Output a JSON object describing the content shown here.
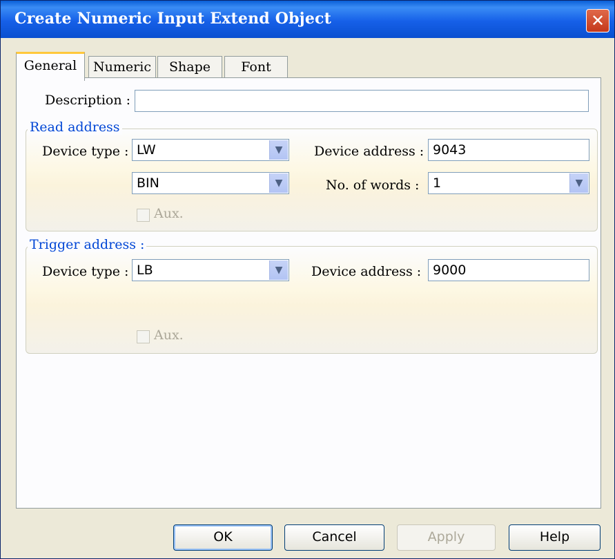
{
  "window": {
    "title": "Create Numeric Input Extend Object",
    "close_icon": "close-icon"
  },
  "tabs": [
    {
      "label": "General",
      "active": true
    },
    {
      "label": "Numeric",
      "active": false
    },
    {
      "label": "Shape",
      "active": false
    },
    {
      "label": "Font",
      "active": false
    }
  ],
  "general": {
    "description_label": "Description :",
    "description_value": ""
  },
  "read_address": {
    "title": "Read address",
    "device_type_label": "Device type :",
    "device_type_value": "LW",
    "format_value": "BIN",
    "device_address_label": "Device address :",
    "device_address_value": "9043",
    "words_label": "No. of words :",
    "words_value": "1",
    "aux_label": "Aux."
  },
  "trigger_address": {
    "title": "Trigger address :",
    "device_type_label": "Device type :",
    "device_type_value": "LB",
    "device_address_label": "Device address :",
    "device_address_value": "9000",
    "aux_label": "Aux."
  },
  "buttons": {
    "ok": "OK",
    "cancel": "Cancel",
    "apply": "Apply",
    "help": "Help"
  },
  "colors": {
    "titlebar": "#1660e8",
    "group_title": "#0046d5",
    "tab_highlight": "#ffc83c",
    "disabled_text": "#aca899"
  }
}
